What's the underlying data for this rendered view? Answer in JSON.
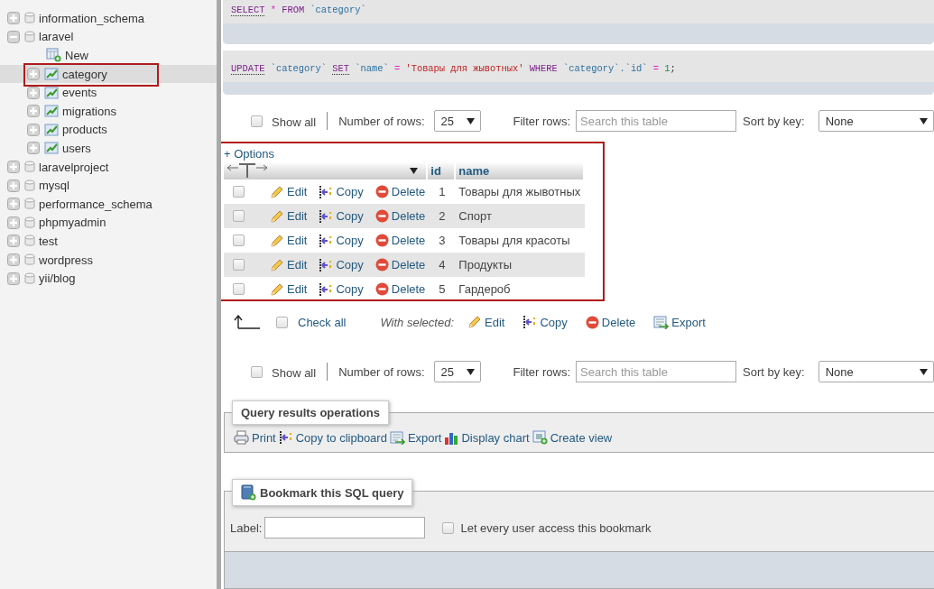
{
  "navigation_tree": [
    {
      "label": "information_schema",
      "kind": "database",
      "expanded": false,
      "selected": false
    },
    {
      "label": "laravel",
      "kind": "database",
      "expanded": true,
      "selected": false,
      "children": [
        {
          "label": "New",
          "kind": "new",
          "selected": false
        },
        {
          "label": "category",
          "kind": "table",
          "expanded": false,
          "selected": true
        },
        {
          "label": "events",
          "kind": "table",
          "expanded": false,
          "selected": false
        },
        {
          "label": "migrations",
          "kind": "table",
          "expanded": false,
          "selected": false
        },
        {
          "label": "products",
          "kind": "table",
          "expanded": false,
          "selected": false
        },
        {
          "label": "users",
          "kind": "table",
          "expanded": false,
          "selected": false
        }
      ]
    },
    {
      "label": "laravelproject",
      "kind": "database",
      "expanded": false,
      "selected": false
    },
    {
      "label": "mysql",
      "kind": "database",
      "expanded": false,
      "selected": false
    },
    {
      "label": "performance_schema",
      "kind": "database",
      "expanded": false,
      "selected": false
    },
    {
      "label": "phpmyadmin",
      "kind": "database",
      "expanded": false,
      "selected": false
    },
    {
      "label": "test",
      "kind": "database",
      "expanded": false,
      "selected": false
    },
    {
      "label": "wordpress",
      "kind": "database",
      "expanded": false,
      "selected": false
    },
    {
      "label": "yii/blog",
      "kind": "database",
      "expanded": false,
      "selected": false
    }
  ],
  "sql_queries": [
    {
      "tokens": [
        {
          "text": "SELECT",
          "kind": "keyword"
        },
        {
          "text": "*",
          "kind": "operator"
        },
        {
          "text": "FROM",
          "kind": "clause"
        },
        {
          "text": "`category`",
          "kind": "identifier"
        }
      ]
    },
    {
      "tokens": [
        {
          "text": "UPDATE",
          "kind": "keyword"
        },
        {
          "text": "`category`",
          "kind": "identifier"
        },
        {
          "text": "SET",
          "kind": "keyword"
        },
        {
          "text": "`name`",
          "kind": "identifier"
        },
        {
          "text": "=",
          "kind": "operator"
        },
        {
          "text": "'Товары для жывотных'",
          "kind": "string"
        },
        {
          "text": "WHERE",
          "kind": "clause"
        },
        {
          "text": "`category`.`id`",
          "kind": "identifier"
        },
        {
          "text": "=",
          "kind": "operator"
        },
        {
          "text": "1",
          "kind": "number"
        },
        {
          "text": ";",
          "kind": "punctuation",
          "tight": true
        }
      ]
    }
  ],
  "top_navigation": {
    "show_all": {
      "label": "Show all",
      "checked": false
    },
    "rows_label": "Number of rows:",
    "rows_value": "25",
    "filter_label": "Filter rows:",
    "filter_placeholder": "Search this table",
    "sort_label": "Sort by key:",
    "sort_value": "None"
  },
  "results": {
    "options_link": "+ Options",
    "columns": [
      "id",
      "name"
    ],
    "rows": [
      {
        "checked": false,
        "id": "1",
        "name": "Товары для жывотных",
        "actions": [
          {
            "label": "Edit",
            "kind": "edit"
          },
          {
            "label": "Copy",
            "kind": "copy"
          },
          {
            "label": "Delete",
            "kind": "delete"
          }
        ]
      },
      {
        "checked": false,
        "id": "2",
        "name": "Спорт",
        "actions": [
          {
            "label": "Edit",
            "kind": "edit"
          },
          {
            "label": "Copy",
            "kind": "copy"
          },
          {
            "label": "Delete",
            "kind": "delete"
          }
        ]
      },
      {
        "checked": false,
        "id": "3",
        "name": "Товары для красоты",
        "actions": [
          {
            "label": "Edit",
            "kind": "edit"
          },
          {
            "label": "Copy",
            "kind": "copy"
          },
          {
            "label": "Delete",
            "kind": "delete"
          }
        ]
      },
      {
        "checked": false,
        "id": "4",
        "name": "Продукты",
        "actions": [
          {
            "label": "Edit",
            "kind": "edit"
          },
          {
            "label": "Copy",
            "kind": "copy"
          },
          {
            "label": "Delete",
            "kind": "delete"
          }
        ]
      },
      {
        "checked": false,
        "id": "5",
        "name": "Гардероб",
        "actions": [
          {
            "label": "Edit",
            "kind": "edit"
          },
          {
            "label": "Copy",
            "kind": "copy"
          },
          {
            "label": "Delete",
            "kind": "delete"
          }
        ]
      }
    ]
  },
  "bulk_actions": {
    "check_all": {
      "label": "Check all",
      "checked": false
    },
    "with_selected": "With selected:",
    "actions": [
      {
        "label": "Edit",
        "kind": "edit"
      },
      {
        "label": "Copy",
        "kind": "copy"
      },
      {
        "label": "Delete",
        "kind": "delete"
      },
      {
        "label": "Export",
        "kind": "export"
      }
    ]
  },
  "bottom_navigation": {
    "show_all": {
      "label": "Show all",
      "checked": false
    },
    "rows_label": "Number of rows:",
    "rows_value": "25",
    "filter_label": "Filter rows:",
    "filter_placeholder": "Search this table",
    "sort_label": "Sort by key:",
    "sort_value": "None"
  },
  "query_operations": {
    "legend": "Query results operations",
    "items": [
      {
        "label": "Print",
        "kind": "print"
      },
      {
        "label": "Copy to clipboard",
        "kind": "copy"
      },
      {
        "label": "Export",
        "kind": "export"
      },
      {
        "label": "Display chart",
        "kind": "chart"
      },
      {
        "label": "Create view",
        "kind": "view"
      }
    ]
  },
  "bookmark": {
    "legend": "Bookmark this SQL query",
    "label_text": "Label:",
    "shared": {
      "label": "Let every user access this bookmark",
      "checked": false
    }
  }
}
